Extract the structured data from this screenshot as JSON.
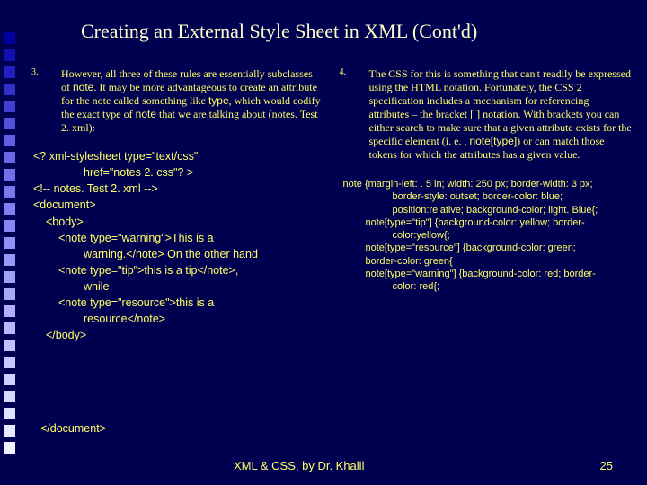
{
  "title": "Creating an External Style Sheet in XML (Cont'd)",
  "left": {
    "num": "3.",
    "para_before": "However, all three of these rules are essentially subclasses of ",
    "note1": "note",
    "para_mid": ". It may be more advantageous to create an attribute for the note called something like ",
    "type1": "type",
    "para_mid2": ", which would codify the exact type of ",
    "note2": "note",
    "para_after": " that we are talking about (notes. Test 2. xml):",
    "code": {
      "l1": "<? xml-stylesheet type=\"text/css\"",
      "l2": "href=\"notes 2. css\"? >",
      "l3": "<!-- notes. Test 2. xml -->",
      "l4": "<document>",
      "l5": "<body>",
      "l6": "<note type=\"warning\">This is a",
      "l7": "warning.</note> On the other hand",
      "l8": "<note type=\"tip\">this is a tip</note>,",
      "l9": "while",
      "l10": "<note type=\"resource\">this is a",
      "l11": "resource</note>",
      "l12": "</body>",
      "l13": "</document>"
    }
  },
  "right": {
    "num": "4.",
    "para_before": "The CSS for this is something that can't readily be expressed using the HTML notation. Fortunately, the CSS 2 specification includes a mechanism for referencing attributes – the bracket [ ] notation. With brackets you can either search to make sure that a given attribute exists for the specific element (i. e. , ",
    "notetype": "note[type]",
    "para_after": ") or can match those tokens for which the attributes has a given value.",
    "css": {
      "l1": "note {margin-left: . 5 in; width: 250 px; border-width: 3 px;",
      "l2": "border-style: outset; border-color: blue;",
      "l3": "position:relative; background-color; light. Blue{;",
      "l4": "note[type=\"tip\"]  {background-color: yellow; border-",
      "l5": "color:yellow{;",
      "l6": "note[type=\"resource\"] {background-color: green;",
      "l7": "border-color: green{",
      "l8": "note[type=\"warning\"] {background-color: red; border-",
      "l9": "color: red{;"
    }
  },
  "footer": {
    "text": "XML & CSS, by Dr. Khalil",
    "page": "25"
  },
  "colors": [
    "#0000a0",
    "#1010b0",
    "#2020c0",
    "#3030c8",
    "#4040d0",
    "#5050d8",
    "#6060e0",
    "#6868e4",
    "#7070e8",
    "#7878ec",
    "#8080f0",
    "#8888f2",
    "#9090f4",
    "#9898f6",
    "#a0a0f8",
    "#a8a8f9",
    "#b0b0fa",
    "#b8b8fb",
    "#c0c0fc",
    "#c8c8fd",
    "#d0d0fe",
    "#d8d8fe",
    "#e0e0ff",
    "#e8e8ff",
    "#f0f0ff"
  ]
}
